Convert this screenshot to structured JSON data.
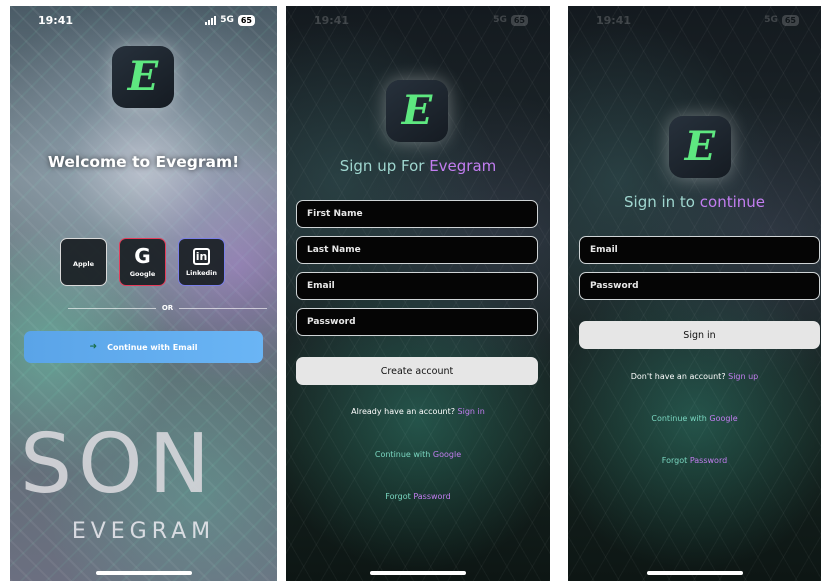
{
  "screen1": {
    "status": {
      "time": "19:41",
      "network": "5G",
      "battery": "65"
    },
    "logo_letter": "E",
    "welcome": "Welcome to Evegram!",
    "social": [
      {
        "label": "Apple",
        "icon": "apple-icon",
        "glyph": ""
      },
      {
        "label": "Google",
        "icon": "google-icon",
        "glyph": "G"
      },
      {
        "label": "Linkedin",
        "icon": "linkedin-icon",
        "glyph": "in"
      }
    ],
    "or_label": "OR",
    "email_button": "Continue with Email",
    "email_arrow": "➜",
    "big_word": "SON",
    "brand_word": "EVEGRAM"
  },
  "screen2": {
    "logo_letter": "E",
    "title_prefix": "Sign up For ",
    "title_accent": "Evegram",
    "fields": {
      "first_name": "First Name",
      "last_name": "Last Name",
      "email": "Email",
      "password": "Password"
    },
    "create_button": "Create account",
    "have_account": "Already have an account?",
    "sign_in_link": "Sign in",
    "continue_prefix": "Continue with ",
    "continue_accent": "Google",
    "forgot_prefix": "Forgot ",
    "forgot_accent": "Password"
  },
  "screen3": {
    "logo_letter": "E",
    "title_prefix": "Sign in to ",
    "title_accent": "continue",
    "fields": {
      "email": "Email",
      "password": "Password"
    },
    "sign_in_button": "Sign in",
    "no_account": "Don't have an account?",
    "sign_up_link": "Sign up",
    "continue_prefix": "Continue with ",
    "continue_accent": "Google",
    "forgot_prefix": "Forgot ",
    "forgot_accent": "Password"
  },
  "colors": {
    "logo_green": "#5ee880",
    "accent_purple": "#c27df0",
    "link_teal": "#7ad6c0",
    "email_button_blue": "#5aa4e8"
  }
}
